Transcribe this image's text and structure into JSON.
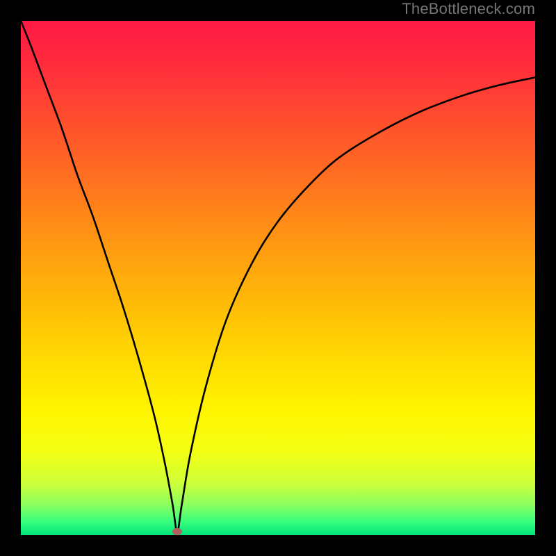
{
  "watermark": "TheBottleneck.com",
  "chart_data": {
    "type": "line",
    "title": "",
    "xlabel": "",
    "ylabel": "",
    "xlim": [
      0,
      100
    ],
    "ylim": [
      0,
      100
    ],
    "notes": "Vertical rainbow gradient background (red at top → orange → yellow → light green → bright green at bottom). A single black curve forms a sharp V dipping to ~0 near x≈30, with both arms rising steeply. The right arm levels off near y≈90 as x→100. A small red-brown dot marks the minimum. No axis ticks or labels are visible; the plot has a thick black border.",
    "gradient_stops": [
      {
        "offset": 0.0,
        "color": "#ff1a44"
      },
      {
        "offset": 0.08,
        "color": "#ff2a3d"
      },
      {
        "offset": 0.18,
        "color": "#ff4a2f"
      },
      {
        "offset": 0.3,
        "color": "#ff6e21"
      },
      {
        "offset": 0.42,
        "color": "#ff9413"
      },
      {
        "offset": 0.54,
        "color": "#ffb808"
      },
      {
        "offset": 0.66,
        "color": "#ffdb02"
      },
      {
        "offset": 0.76,
        "color": "#fff500"
      },
      {
        "offset": 0.84,
        "color": "#f3ff14"
      },
      {
        "offset": 0.9,
        "color": "#ccff3a"
      },
      {
        "offset": 0.94,
        "color": "#8dff5e"
      },
      {
        "offset": 0.975,
        "color": "#35ff7e"
      },
      {
        "offset": 1.0,
        "color": "#00e37a"
      }
    ],
    "series": [
      {
        "name": "curve",
        "x": [
          0,
          2,
          5,
          8,
          11,
          14,
          17,
          20,
          23,
          26,
          28,
          29.5,
          30.4,
          31.3,
          33,
          36,
          40,
          45,
          50,
          56,
          62,
          70,
          78,
          86,
          93,
          100
        ],
        "y": [
          100,
          95,
          87,
          79,
          70,
          62,
          53,
          44,
          34,
          23,
          14,
          6,
          0.7,
          6,
          16,
          29,
          42,
          53,
          61,
          68,
          73.5,
          78.5,
          82.5,
          85.5,
          87.5,
          89
        ]
      }
    ],
    "marker": {
      "x": 30.4,
      "y": 0.7,
      "color": "#b16060"
    }
  }
}
